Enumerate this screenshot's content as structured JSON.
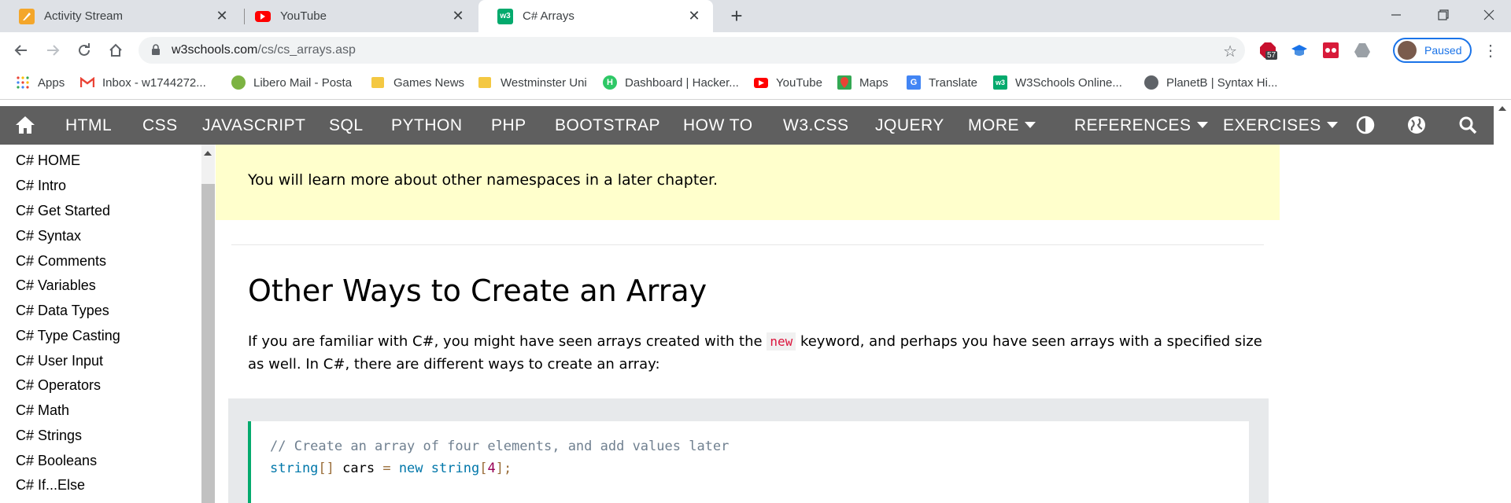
{
  "browser": {
    "tabs": [
      {
        "title": "Activity Stream",
        "icon": "activity-stream-icon",
        "color": "#f4a62a"
      },
      {
        "title": "YouTube",
        "icon": "youtube-icon",
        "color": "#ff0000"
      },
      {
        "title": "C# Arrays",
        "icon": "w3schools-icon",
        "color": "#04aa6d"
      }
    ],
    "tab_close": "✕",
    "new_tab": "+",
    "address": {
      "host": "w3schools.com",
      "path": "/cs/cs_arrays.asp"
    },
    "extension_badge": "57",
    "profile_label": "Paused"
  },
  "bookmarks": [
    {
      "label": "Apps",
      "icon": "apps-grid-icon"
    },
    {
      "label": "Inbox - w1744272...",
      "icon": "gmail-icon"
    },
    {
      "label": "Libero Mail - Posta",
      "icon": "libero-icon"
    },
    {
      "label": "Games News",
      "icon": "folder-icon"
    },
    {
      "label": "Westminster Uni",
      "icon": "folder-icon"
    },
    {
      "label": "Dashboard | Hacker...",
      "icon": "hackerrank-icon"
    },
    {
      "label": "YouTube",
      "icon": "youtube-icon"
    },
    {
      "label": "Maps",
      "icon": "maps-icon"
    },
    {
      "label": "Translate",
      "icon": "translate-icon"
    },
    {
      "label": "W3Schools Online...",
      "icon": "w3schools-icon"
    },
    {
      "label": "PlanetB | Syntax Hi...",
      "icon": "globe-icon"
    }
  ],
  "w3nav": {
    "items": [
      "HTML",
      "CSS",
      "JAVASCRIPT",
      "SQL",
      "PYTHON",
      "PHP",
      "BOOTSTRAP",
      "HOW TO",
      "W3.CSS",
      "JQUERY"
    ],
    "more": "MORE",
    "references": "REFERENCES",
    "exercises": "EXERCISES"
  },
  "sidebar": {
    "links": [
      "C# HOME",
      "C# Intro",
      "C# Get Started",
      "C# Syntax",
      "C# Comments",
      "C# Variables",
      "C# Data Types",
      "C# Type Casting",
      "C# User Input",
      "C# Operators",
      "C# Math",
      "C# Strings",
      "C# Booleans",
      "C# If...Else"
    ]
  },
  "main": {
    "note": "You will learn more about other namespaces in a later chapter.",
    "heading": "Other Ways to Create an Array",
    "para_before": "If you are familiar with C#, you might have seen arrays created with the",
    "para_keyword": "new",
    "para_after": "keyword, and perhaps you have seen arrays with a specified size as well. In C#, there are different ways to create an array:",
    "code": {
      "comment": "// Create an array of four elements, and add values later",
      "type1": "string",
      "brackets1": "[]",
      "var": " cars ",
      "eq": "=",
      "kw_new": " new ",
      "type2": "string",
      "bracket_open": "[",
      "size": "4",
      "bracket_close": "]",
      "semi": ";"
    }
  }
}
